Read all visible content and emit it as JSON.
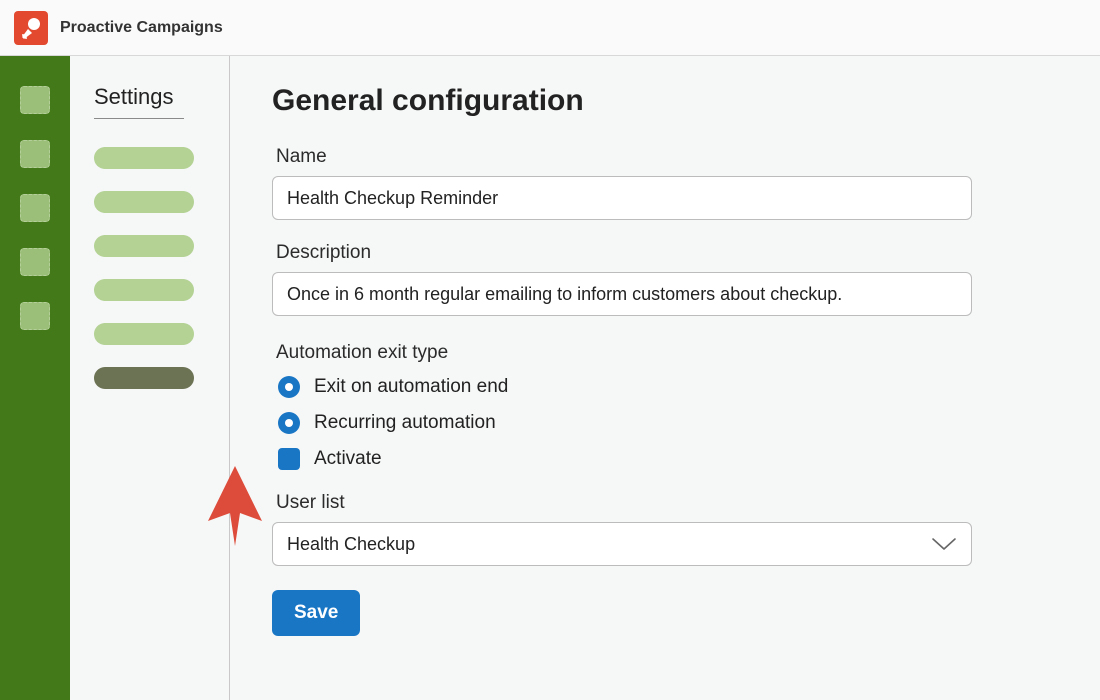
{
  "app": {
    "title": "Proactive Campaigns"
  },
  "sidebar": {
    "title": "Settings"
  },
  "page": {
    "heading": "General configuration",
    "name_label": "Name",
    "name_value": "Health Checkup Reminder",
    "description_label": "Description",
    "description_value": "Once in 6 month regular emailing to inform customers about checkup.",
    "exit_type_label": "Automation exit type",
    "option_exit_end": "Exit on automation end",
    "option_recurring": "Recurring automation",
    "option_activate": "Activate",
    "user_list_label": "User list",
    "user_list_value": "Health Checkup",
    "save_label": "Save"
  }
}
